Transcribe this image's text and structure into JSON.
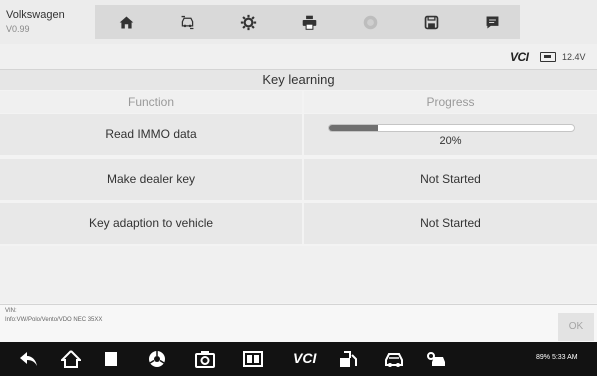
{
  "header": {
    "vehicle": "Volkswagen",
    "version": "V0.99",
    "toolbar": [
      {
        "icon": "home-icon"
      },
      {
        "icon": "vehicle-swap-icon"
      },
      {
        "icon": "gear-icon"
      },
      {
        "icon": "printer-icon"
      },
      {
        "icon": "help-icon"
      },
      {
        "icon": "save-icon"
      },
      {
        "icon": "message-icon"
      }
    ]
  },
  "status": {
    "vci": "VCI",
    "voltage": "12.4V"
  },
  "main": {
    "title": "Key learning",
    "columns": {
      "function": "Function",
      "progress": "Progress"
    },
    "rows": [
      {
        "function": "Read IMMO data",
        "progress": "20%",
        "progress_fraction": 0.2
      },
      {
        "function": "Make dealer key",
        "progress": "Not Started"
      },
      {
        "function": "Key adaption to vehicle",
        "progress": "Not Started"
      }
    ]
  },
  "info": {
    "vin_label": "VIN:",
    "info_text": "Info:VW/Polo/Vento/VDO NEC 35XX",
    "ok_label": "OK"
  },
  "navbar": {
    "vci": "VCI",
    "status": "89% 5:33 AM",
    "icons": [
      "back-icon",
      "home-icon",
      "recent-apps-icon",
      "browser-icon",
      "camera-icon",
      "screen-capture-icon",
      "vci-icon",
      "fuel-icon",
      "car-service-icon",
      "car-repair-icon"
    ]
  },
  "colors": {
    "progress_fill": "#6f6f6f",
    "navbar": "#121212",
    "toolbar": "#d9d9d9"
  }
}
